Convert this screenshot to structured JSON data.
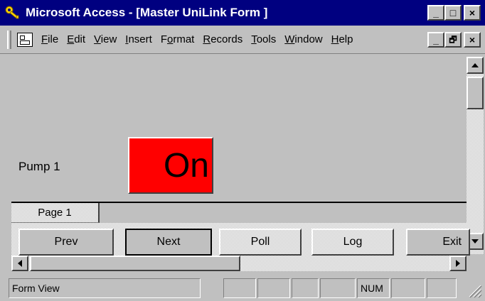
{
  "window": {
    "title": "Microsoft Access - [Master UniLink Form ]",
    "title_bar_color": "#000080",
    "controls": {
      "minimize": "_",
      "maximize": "□",
      "close": "×"
    }
  },
  "menubar": {
    "items": [
      {
        "label": "File",
        "ul": "F",
        "rest": "ile"
      },
      {
        "label": "Edit",
        "ul": "E",
        "rest": "dit"
      },
      {
        "label": "View",
        "ul": "V",
        "rest": "iew"
      },
      {
        "label": "Insert",
        "ul": "I",
        "rest": "nsert"
      },
      {
        "label": "Format",
        "pre": "F",
        "ul": "o",
        "rest": "rmat"
      },
      {
        "label": "Records",
        "ul": "R",
        "rest": "ecords"
      },
      {
        "label": "Tools",
        "ul": "T",
        "rest": "ools"
      },
      {
        "label": "Window",
        "ul": "W",
        "rest": "indow"
      },
      {
        "label": "Help",
        "ul": "H",
        "rest": "elp"
      }
    ],
    "doc_controls": {
      "minimize": "_",
      "restore": "🗗",
      "close": "×"
    }
  },
  "form": {
    "pump_label": "Pump 1",
    "pump_state": "On",
    "pump_state_color": "#ff0000",
    "page_tab": "Page 1",
    "buttons": {
      "prev": "Prev",
      "next": "Next",
      "poll": "Poll",
      "log": "Log",
      "exit": "Exit"
    }
  },
  "statusbar": {
    "text": "Form View",
    "num_indicator": "NUM"
  },
  "icons": {
    "app": "access-key-icon",
    "form": "form-view-icon"
  }
}
